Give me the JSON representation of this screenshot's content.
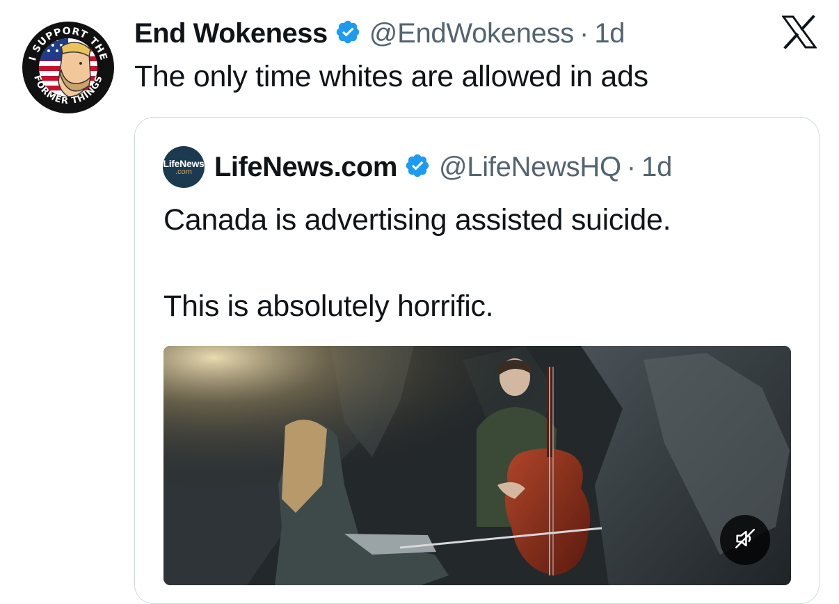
{
  "post": {
    "author_name": "End Wokeness",
    "handle": "@EndWokeness",
    "separator": "·",
    "timestamp": "1d",
    "text": "The only time whites are allowed in ads",
    "avatar_text_top": "I SUPPORT THE",
    "avatar_text_bottom": "FORMER THINGS"
  },
  "quoted_post": {
    "author_name": "LifeNews.com",
    "handle": "@LifeNewsHQ",
    "separator": "·",
    "timestamp": "1d",
    "avatar_line1": "LifeNews",
    "avatar_line2": ".com",
    "text_lines": [
      "Canada is advertising assisted suicide.",
      "This is absolutely horrific."
    ]
  },
  "icons": {
    "brand": "x-logo-icon",
    "verified": "verified-badge-icon",
    "mute": "volume-muted-icon"
  },
  "colors": {
    "verified": "#1d9bf0",
    "text_primary": "#0f1419",
    "text_secondary": "#536471",
    "border": "#cfd9de"
  }
}
